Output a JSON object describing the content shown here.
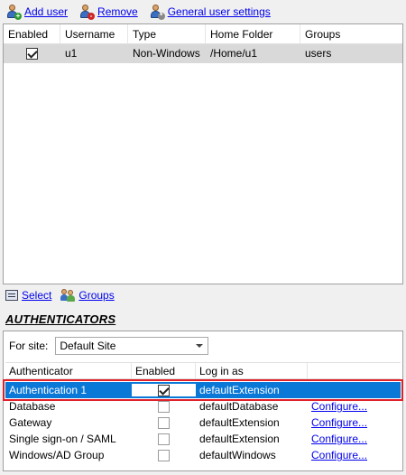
{
  "toolbar": {
    "add_user": "Add user",
    "remove": "Remove",
    "general_settings": "General user settings"
  },
  "users_table": {
    "columns": [
      "Enabled",
      "Username",
      "Type",
      "Home Folder",
      "Groups"
    ],
    "rows": [
      {
        "enabled": true,
        "username": "u1",
        "type": "Non-Windows",
        "home_folder": "/Home/u1",
        "groups": "users"
      }
    ]
  },
  "bottom_links": {
    "select": "Select",
    "groups": "Groups"
  },
  "authenticators": {
    "heading": "AUTHENTICATORS",
    "for_site_label": "For site:",
    "site_value": "Default Site",
    "columns": [
      "Authenticator",
      "Enabled",
      "Log in as",
      ""
    ],
    "rows": [
      {
        "name": "Authentication 1",
        "enabled": true,
        "login_as": "defaultExtension",
        "action": ""
      },
      {
        "name": "Database",
        "enabled": false,
        "login_as": "defaultDatabase",
        "action": "Configure..."
      },
      {
        "name": "Gateway",
        "enabled": false,
        "login_as": "defaultExtension",
        "action": "Configure..."
      },
      {
        "name": "Single sign-on / SAML",
        "enabled": false,
        "login_as": "defaultExtension",
        "action": "Configure..."
      },
      {
        "name": "Windows/AD Group",
        "enabled": false,
        "login_as": "defaultWindows",
        "action": "Configure..."
      }
    ]
  },
  "colors": {
    "selection": "#0a78d7",
    "highlight_border": "#e2202a",
    "link": "#0000ee"
  }
}
